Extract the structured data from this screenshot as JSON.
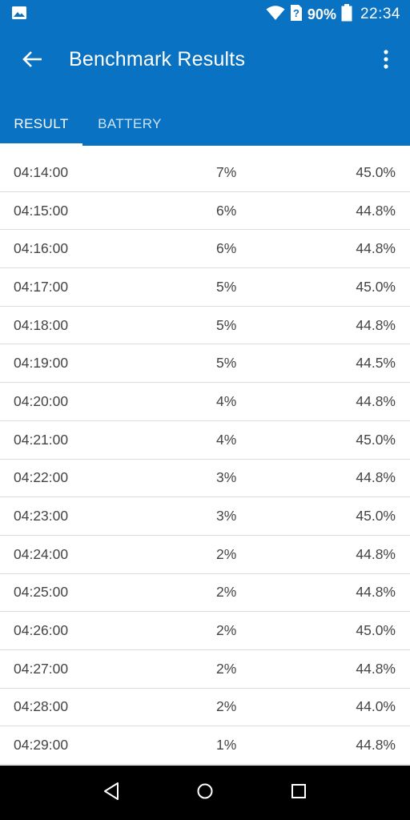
{
  "status_bar": {
    "battery_percent": "90%",
    "time": "22:34",
    "icons": [
      "image-notification-icon",
      "wifi-icon",
      "no-sim-icon",
      "battery-icon"
    ]
  },
  "app_bar": {
    "title": "Benchmark Results",
    "back_icon": "arrow-back-icon",
    "menu_icon": "more-vertical-icon"
  },
  "tabs": [
    {
      "label": "RESULT",
      "selected": true
    },
    {
      "label": "BATTERY",
      "selected": false
    }
  ],
  "rows": [
    {
      "time": "04:14:00",
      "level": "7%",
      "temp": "45.0%"
    },
    {
      "time": "04:15:00",
      "level": "6%",
      "temp": "44.8%"
    },
    {
      "time": "04:16:00",
      "level": "6%",
      "temp": "44.8%"
    },
    {
      "time": "04:17:00",
      "level": "5%",
      "temp": "45.0%"
    },
    {
      "time": "04:18:00",
      "level": "5%",
      "temp": "44.8%"
    },
    {
      "time": "04:19:00",
      "level": "5%",
      "temp": "44.5%"
    },
    {
      "time": "04:20:00",
      "level": "4%",
      "temp": "44.8%"
    },
    {
      "time": "04:21:00",
      "level": "4%",
      "temp": "45.0%"
    },
    {
      "time": "04:22:00",
      "level": "3%",
      "temp": "44.8%"
    },
    {
      "time": "04:23:00",
      "level": "3%",
      "temp": "45.0%"
    },
    {
      "time": "04:24:00",
      "level": "2%",
      "temp": "44.8%"
    },
    {
      "time": "04:25:00",
      "level": "2%",
      "temp": "44.8%"
    },
    {
      "time": "04:26:00",
      "level": "2%",
      "temp": "45.0%"
    },
    {
      "time": "04:27:00",
      "level": "2%",
      "temp": "44.8%"
    },
    {
      "time": "04:28:00",
      "level": "2%",
      "temp": "44.0%"
    },
    {
      "time": "04:29:00",
      "level": "1%",
      "temp": "44.8%"
    }
  ],
  "colors": {
    "primary": "#0a72c2",
    "text": "#444444",
    "divider": "#dcdcdc"
  }
}
